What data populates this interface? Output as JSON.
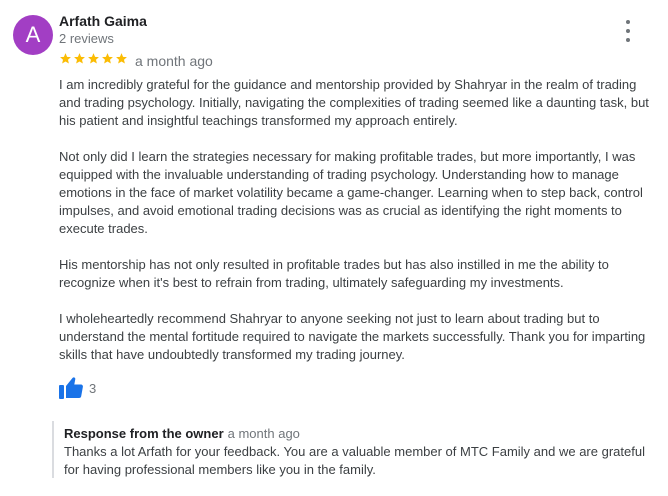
{
  "review": {
    "avatar_letter": "A",
    "avatar_color": "#a23ec4",
    "author": "Arfath Gaima",
    "reviews_count": "2 reviews",
    "rating": 5,
    "star_color": "#fbbc04",
    "time": "a month ago",
    "paragraphs": [
      "I am incredibly grateful for the guidance and mentorship provided by Shahryar in the realm of trading and trading psychology. Initially, navigating the complexities of trading seemed like a daunting task, but his patient and insightful teachings transformed my approach entirely.",
      "Not only did I learn the strategies necessary for making profitable trades, but more importantly, I was equipped with the invaluable understanding of trading psychology. Understanding how to manage emotions in the face of market volatility became a game-changer. Learning when to step back, control impulses, and avoid emotional trading decisions was as crucial as identifying the right moments to execute trades.",
      "His mentorship has not only resulted in profitable trades but has also instilled in me the ability to recognize when it's best to refrain from trading, ultimately safeguarding my investments.",
      "I wholeheartedly recommend Shahryar to anyone seeking not just to learn about trading but to understand the mental fortitude required to navigate the markets successfully. Thank you for imparting skills that have undoubtedly transformed my trading journey."
    ],
    "likes": "3",
    "like_color": "#1a73e8"
  },
  "owner_response": {
    "title": "Response from the owner",
    "time": "a month ago",
    "text": "Thanks a lot Arfath for your feedback. You are a valuable member of MTC Family and we are grateful for having professional members like you in the family."
  }
}
